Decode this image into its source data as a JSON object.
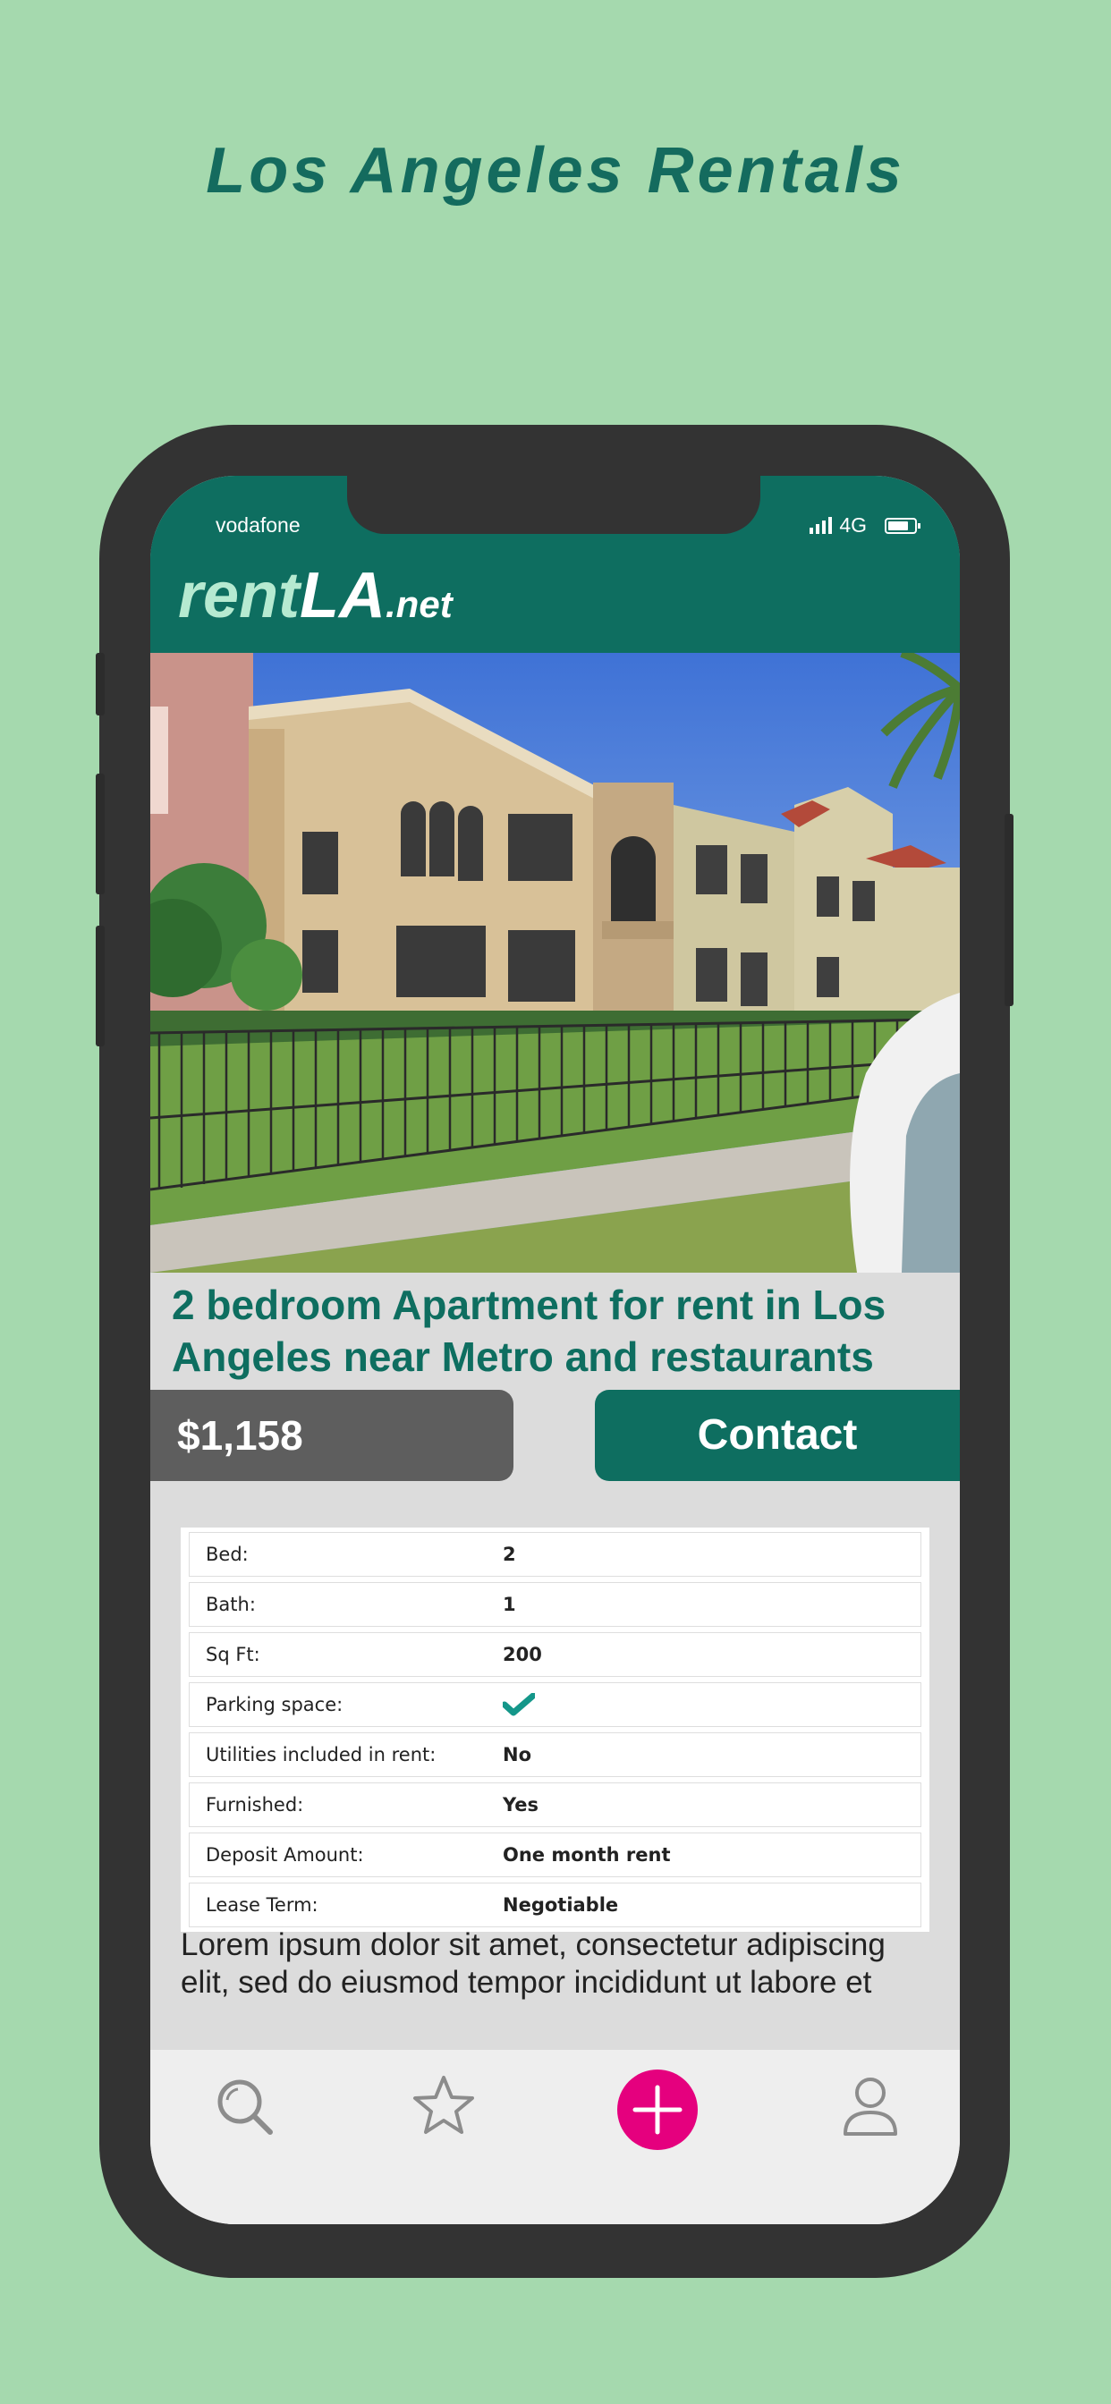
{
  "page": {
    "headline": "Los Angeles Rentals",
    "background": "#a5d9ae",
    "headline_color": "#146b5e"
  },
  "status": {
    "carrier": "vodafone",
    "network": "4G"
  },
  "brand": {
    "part1": "rent",
    "part2": "LA",
    "part3": ".net",
    "color": "#0e6e60"
  },
  "listing": {
    "title": "2 bedroom Apartment for rent in Los Angeles near Metro and restaurants",
    "price": "$1,158",
    "contact_label": "Contact",
    "details": [
      {
        "label": "Bed:",
        "value": "2"
      },
      {
        "label": "Bath:",
        "value": "1"
      },
      {
        "label": "Sq Ft:",
        "value": "200"
      },
      {
        "label": "Parking space:",
        "value": "",
        "icon": "checkmark-icon"
      },
      {
        "label": "Utilities included in rent:",
        "value": "No"
      },
      {
        "label": "Furnished:",
        "value": "Yes"
      },
      {
        "label": "Deposit Amount:",
        "value": "One month rent"
      },
      {
        "label": "Lease Term:",
        "value": "Negotiable"
      }
    ],
    "description": "Lorem ipsum dolor sit amet, consectetur adipiscing elit, sed do eiusmod tempor incididunt ut labore et"
  },
  "tabbar": {
    "items": [
      {
        "icon": "search-icon"
      },
      {
        "icon": "star-icon"
      },
      {
        "icon": "add-icon",
        "color": "#e5007e"
      },
      {
        "icon": "profile-icon"
      }
    ]
  }
}
